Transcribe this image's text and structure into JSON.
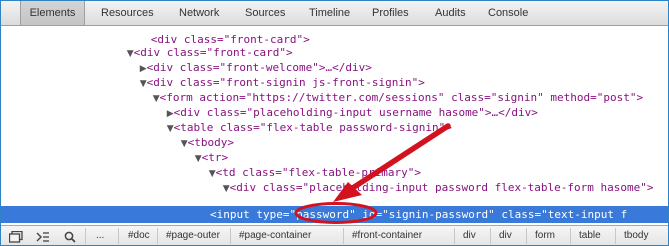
{
  "tabs": [
    {
      "label": "Elements",
      "active": true
    },
    {
      "label": "Resources",
      "active": false
    },
    {
      "label": "Network",
      "active": false
    },
    {
      "label": "Sources",
      "active": false
    },
    {
      "label": "Timeline",
      "active": false
    },
    {
      "label": "Profiles",
      "active": false
    },
    {
      "label": "Audits",
      "active": false
    },
    {
      "label": "Console",
      "active": false
    }
  ],
  "dom_lines": [
    {
      "cut": "<div class=\"front-card\">"
    },
    {
      "text": "<div class=\"front-card\">"
    },
    {
      "text": "<div class=\"front-welcome\">…</div>"
    },
    {
      "text": "<div class=\"front-signin js-front-signin\">"
    },
    {
      "text": "<form action=\"https://twitter.com/sessions\" class=\"signin\" method=\"post\">"
    },
    {
      "text": "<div class=\"placeholding-input username hasome\">…</div>"
    },
    {
      "text": "<table class=\"flex-table password-signin\">"
    },
    {
      "text": "<tbody>"
    },
    {
      "text": "<tr>"
    },
    {
      "text": "<td class=\"flex-table-primary\">"
    },
    {
      "text": "<div class=\"placeholding-input password flex-table-form hasome\">"
    }
  ],
  "selected_line": "<input type=\"password\" id=\"signin-password\" class=\"text-input f",
  "breadcrumbs": [
    "#doc",
    "#page-outer",
    "#page-container",
    "#front-container",
    "div",
    "div",
    "form",
    "table",
    "tbody"
  ],
  "toolbar": {
    "ellipsis": "..."
  },
  "icons": [
    "dock-icon",
    "console-drawer-icon",
    "search-icon"
  ],
  "accent_color": "#3879d9",
  "annotation_color": "#d4121e"
}
